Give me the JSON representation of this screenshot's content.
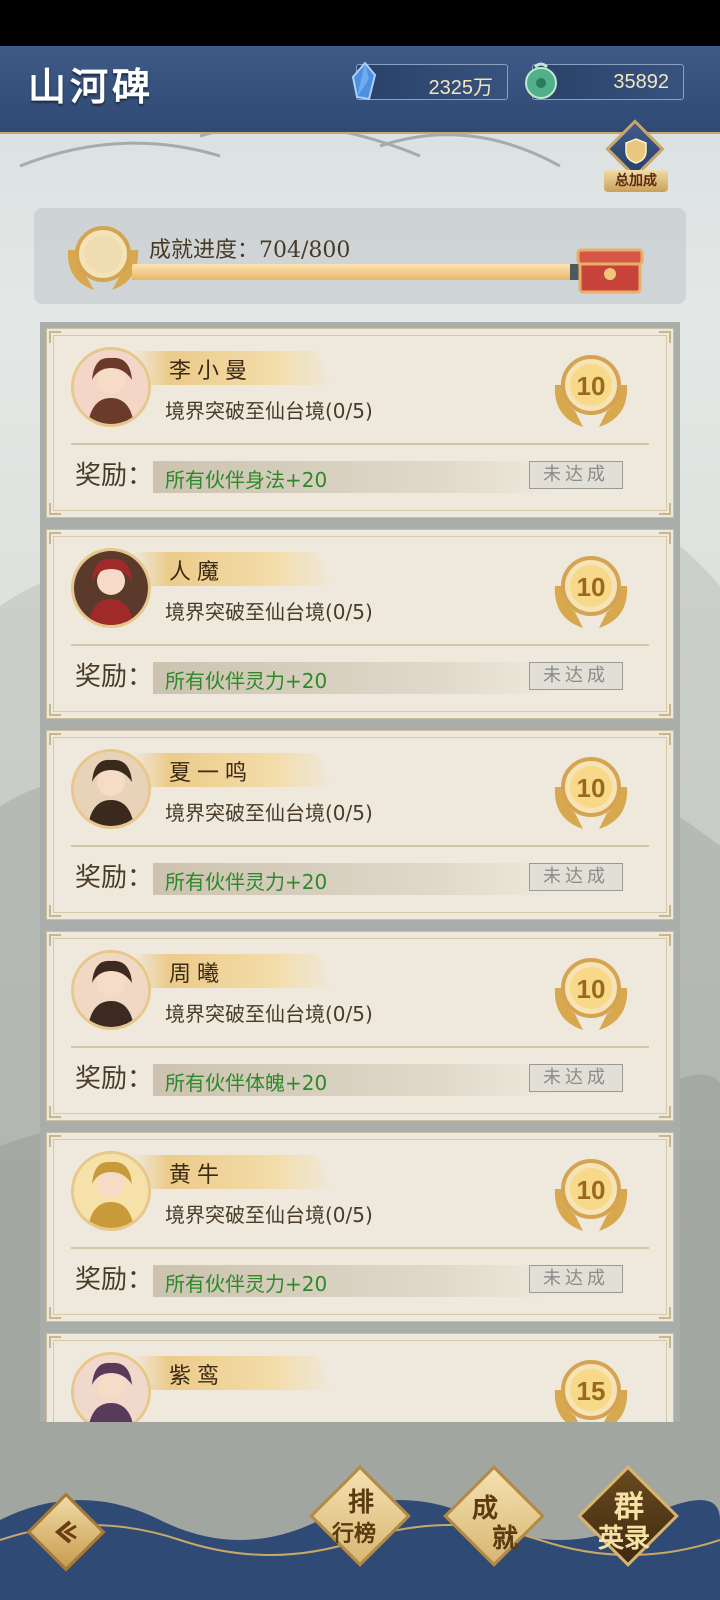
{
  "header": {
    "title": "山河碑",
    "currencies": [
      {
        "icon": "blue-crystal-icon",
        "value": "2325万"
      },
      {
        "icon": "jade-coin-icon",
        "value": "35892"
      }
    ]
  },
  "bonus_badge": {
    "label": "总加成",
    "icon": "shield-icon"
  },
  "progress": {
    "label": "成就进度：704/800",
    "current": 704,
    "total": 800,
    "fraction": 0.88
  },
  "achievements": [
    {
      "name": "李小曼",
      "condition": "境界突破至仙台境(0/5)",
      "points": "10",
      "reward_label": "奖励：",
      "reward": "所有伙伴身法+20",
      "status": "未达成"
    },
    {
      "name": "人魔",
      "condition": "境界突破至仙台境(0/5)",
      "points": "10",
      "reward_label": "奖励：",
      "reward": "所有伙伴灵力+20",
      "status": "未达成"
    },
    {
      "name": "夏一鸣",
      "condition": "境界突破至仙台境(0/5)",
      "points": "10",
      "reward_label": "奖励：",
      "reward": "所有伙伴灵力+20",
      "status": "未达成"
    },
    {
      "name": "周曦",
      "condition": "境界突破至仙台境(0/5)",
      "points": "10",
      "reward_label": "奖励：",
      "reward": "所有伙伴体魄+20",
      "status": "未达成"
    },
    {
      "name": "黄牛",
      "condition": "境界突破至仙台境(0/5)",
      "points": "10",
      "reward_label": "奖励：",
      "reward": "所有伙伴灵力+20",
      "status": "未达成"
    },
    {
      "name": "紫鸾",
      "condition": "",
      "points": "15",
      "reward_label": "",
      "reward": "",
      "status": ""
    }
  ],
  "bottom_nav": [
    {
      "line1": "排",
      "line2": "行榜",
      "active": false
    },
    {
      "line1": "成",
      "line2": "就",
      "active": false
    },
    {
      "line1": "群",
      "line2": "英录",
      "active": true
    }
  ],
  "colors": {
    "header_blue": "#34507c",
    "gold": "#d9b774",
    "reward_green": "#2c8a2a",
    "card_bg": "#eee9dc"
  }
}
